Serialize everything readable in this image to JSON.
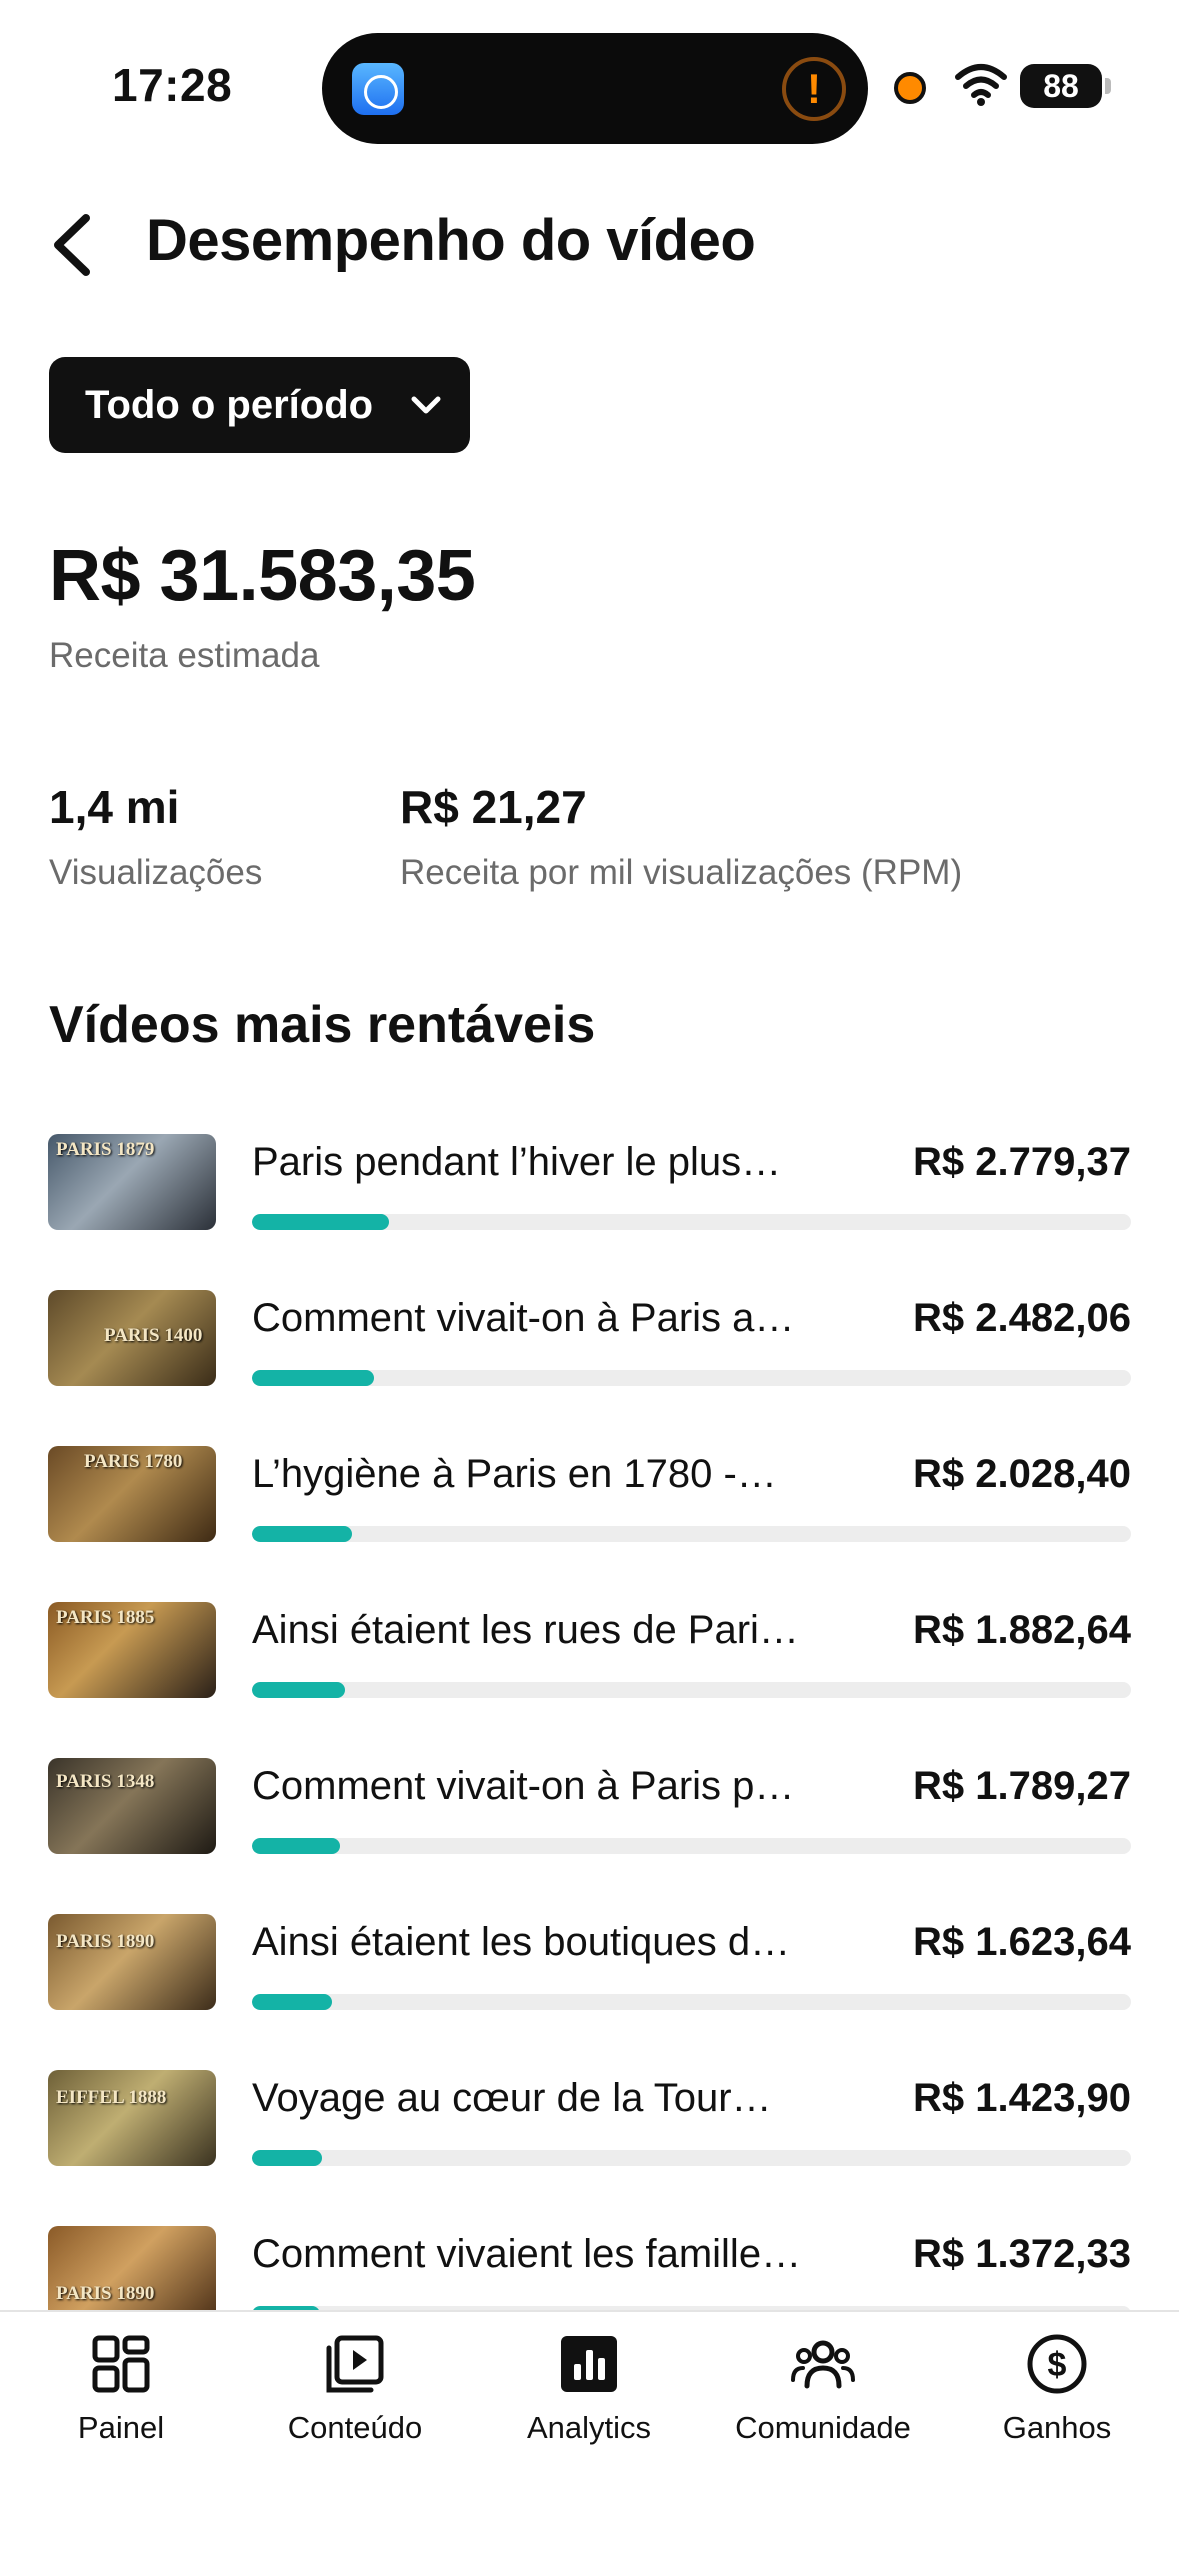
{
  "status_bar": {
    "time": "17:28",
    "battery": "88"
  },
  "header": {
    "title": "Desempenho do vídeo"
  },
  "period_filter": {
    "label": "Todo o período"
  },
  "summary": {
    "revenue_value": "R$ 31.583,35",
    "revenue_label": "Receita estimada",
    "views_value": "1,4 mi",
    "views_label": "Visualizações",
    "rpm_value": "R$ 21,27",
    "rpm_label": "Receita por mil visualizações (RPM)"
  },
  "section": {
    "title": "Vídeos mais rentáveis"
  },
  "videos": [
    {
      "title": "Paris pendant l’hiver le plus…",
      "revenue": "R$ 2.779,37",
      "thumb_label": "PARIS 1879",
      "share": 0.156
    },
    {
      "title": "Comment vivait-on à Paris a…",
      "revenue": "R$ 2.482,06",
      "thumb_label": "PARIS 1400",
      "share": 0.139
    },
    {
      "title": "L’hygiène à Paris en 1780 -…",
      "revenue": "R$ 2.028,40",
      "thumb_label": "PARIS 1780",
      "share": 0.114
    },
    {
      "title": "Ainsi étaient les rues de Pari…",
      "revenue": "R$ 1.882,64",
      "thumb_label": "PARIS 1885",
      "share": 0.106
    },
    {
      "title": "Comment vivait-on à Paris p…",
      "revenue": "R$ 1.789,27",
      "thumb_label": "PARIS 1348",
      "share": 0.1
    },
    {
      "title": "Ainsi étaient les boutiques d…",
      "revenue": "R$ 1.623,64",
      "thumb_label": "PARIS 1890",
      "share": 0.091
    },
    {
      "title": "Voyage au cœur de la Tour…",
      "revenue": "R$ 1.423,90",
      "thumb_label": "EIFFEL 1888",
      "share": 0.08
    },
    {
      "title": "Comment vivaient les famille…",
      "revenue": "R$ 1.372,33",
      "thumb_label": "PARIS 1890",
      "share": 0.077
    }
  ],
  "tabs": [
    {
      "label": "Painel",
      "icon": "dashboard-icon"
    },
    {
      "label": "Conteúdo",
      "icon": "content-icon"
    },
    {
      "label": "Analytics",
      "icon": "analytics-icon"
    },
    {
      "label": "Comunidade",
      "icon": "community-icon"
    },
    {
      "label": "Ganhos",
      "icon": "earnings-icon"
    }
  ],
  "colors": {
    "accent": "#14b3a6",
    "bar_track": "#ededed",
    "text_secondary": "#6b6b6b",
    "button_bg": "#111111"
  }
}
